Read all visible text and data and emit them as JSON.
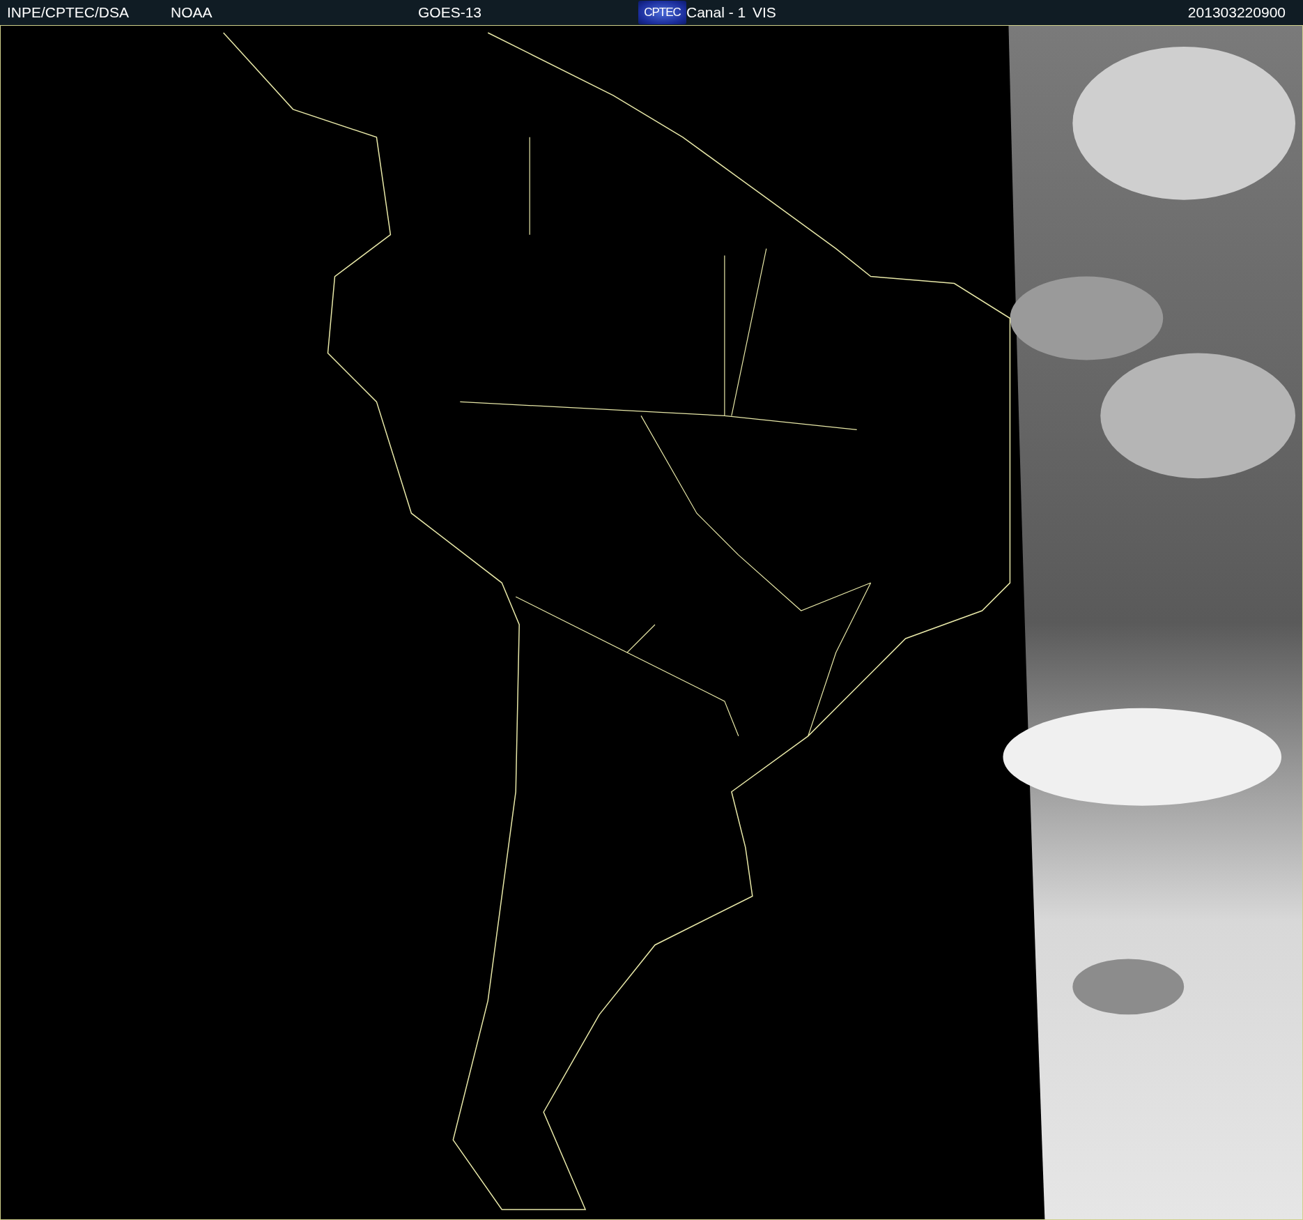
{
  "header": {
    "source": "INPE/CPTEC/DSA",
    "agency": "NOAA",
    "satellite": "GOES-13",
    "logo": "CPTEC",
    "channel": "Canal - 1",
    "band": "VIS",
    "timestamp": "201303220900"
  }
}
